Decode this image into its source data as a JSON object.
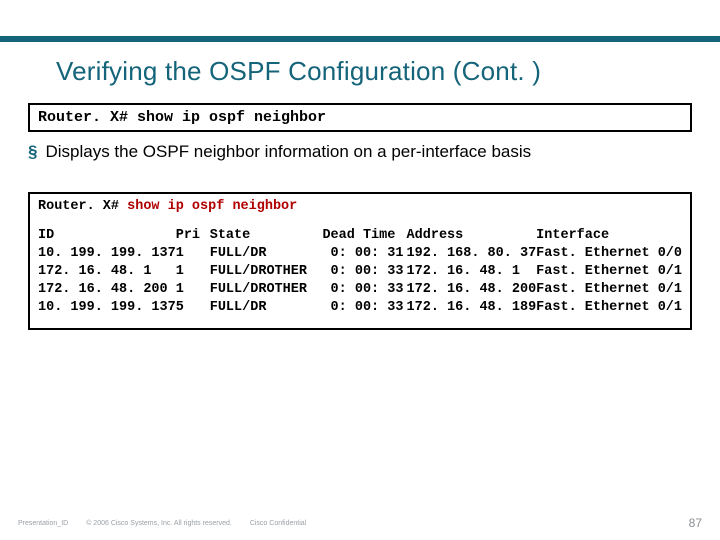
{
  "slide": {
    "title": "Verifying the OSPF Configuration (Cont. )"
  },
  "cmdbox1": {
    "text": "Router. X# show ip ospf neighbor"
  },
  "bullet": {
    "marker": "§",
    "text": "Displays the OSPF neighbor information on a per-interface basis"
  },
  "output": {
    "prompt": "Router. X#",
    "command": "show ip ospf neighbor",
    "columns": {
      "c0": "ID\n10. 199. 199. 137\n172. 16. 48. 1\n172. 16. 48. 200\n10. 199. 199. 137",
      "c1": "Pri\n1\n1\n1\n5",
      "c2": "State\nFULL/DR\nFULL/DROTHER\nFULL/DROTHER\nFULL/DR",
      "c3": "Dead Time\n 0: 00: 31\n 0: 00: 33\n 0: 00: 33\n 0: 00: 33",
      "c4": "Address\n192. 168. 80. 37\n172. 16. 48. 1\n172. 16. 48. 200\n172. 16. 48. 189",
      "c5": "Interface\nFast. Ethernet 0/0\nFast. Ethernet 0/1\nFast. Ethernet 0/1\nFast. Ethernet 0/1"
    }
  },
  "footer": {
    "presentation_id": "Presentation_ID",
    "copyright": "© 2006 Cisco Systems, Inc. All rights reserved.",
    "confidential": "Cisco Confidential",
    "pagenum": "87"
  },
  "chart_data": {
    "type": "table",
    "title": "show ip ospf neighbor",
    "columns": [
      "ID",
      "Pri",
      "State",
      "Dead Time",
      "Address",
      "Interface"
    ],
    "rows": [
      [
        "10.199.199.137",
        1,
        "FULL/DR",
        "0:00:31",
        "192.168.80.37",
        "FastEthernet0/0"
      ],
      [
        "172.16.48.1",
        1,
        "FULL/DROTHER",
        "0:00:33",
        "172.16.48.1",
        "FastEthernet0/1"
      ],
      [
        "172.16.48.200",
        1,
        "FULL/DROTHER",
        "0:00:33",
        "172.16.48.200",
        "FastEthernet0/1"
      ],
      [
        "10.199.199.137",
        5,
        "FULL/DR",
        "0:00:33",
        "172.16.48.189",
        "FastEthernet0/1"
      ]
    ]
  }
}
